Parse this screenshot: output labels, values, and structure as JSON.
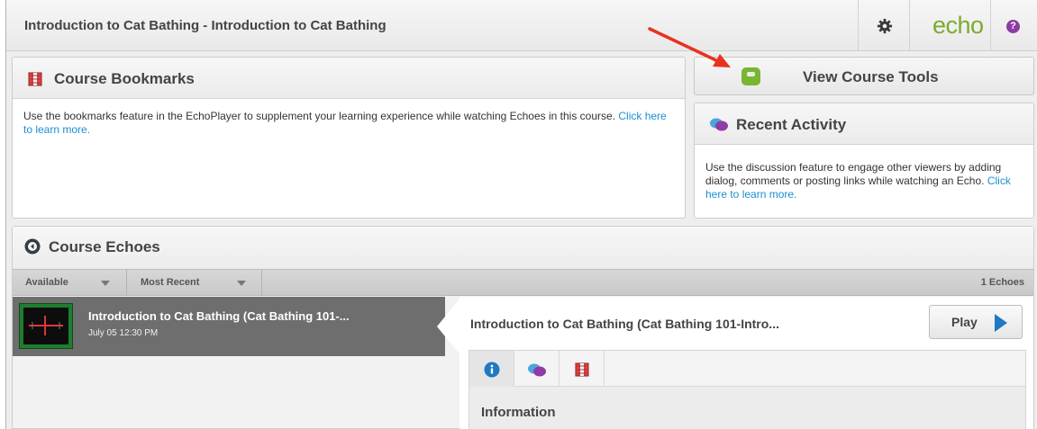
{
  "header": {
    "title": "Introduction to Cat Bathing - Introduction to Cat Bathing",
    "logo_text": "echo",
    "help_glyph": "?",
    "settings_icon": "gear-icon"
  },
  "bookmarks": {
    "title": "Course Bookmarks",
    "body": "Use the bookmarks feature in the EchoPlayer to supplement your learning experience while watching Echoes in this course.",
    "link": "Click here to learn more."
  },
  "tools": {
    "label": "View Course Tools"
  },
  "recent": {
    "title": "Recent Activity",
    "body": "Use the discussion feature to engage other viewers by adding dialog, comments or posting links while watching an Echo.",
    "link": "Click here to learn more."
  },
  "echoes": {
    "title": "Course Echoes",
    "filters": [
      "Available",
      "Most Recent"
    ],
    "count": "1 Echoes",
    "items": [
      {
        "title": "Introduction to Cat Bathing (Cat Bathing 101-...",
        "date": "July 05 12:30 PM"
      }
    ],
    "detail": {
      "title": "Introduction to Cat Bathing (Cat Bathing 101-Intro...",
      "play_label": "Play",
      "tabs": [
        "info-icon",
        "discussion-icon",
        "bookmark-icon"
      ],
      "section_label": "Information"
    }
  },
  "colors": {
    "accent_green": "#7ab532",
    "link_blue": "#1a8fd1",
    "play_blue": "#1f79c3",
    "annotation_red": "#e8321e"
  }
}
